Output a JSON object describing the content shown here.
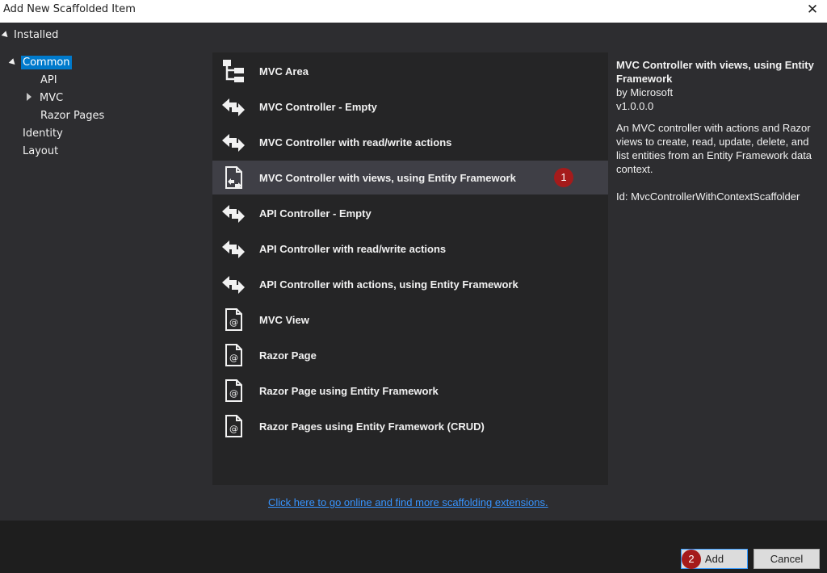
{
  "window": {
    "title": "Add New Scaffolded Item",
    "close_icon": "close-icon"
  },
  "tree": {
    "root_label": "Installed",
    "items": [
      {
        "label": "Common",
        "selected": true
      },
      {
        "label": "API"
      },
      {
        "label": "MVC",
        "expandable": true
      },
      {
        "label": "Razor Pages"
      },
      {
        "label": "Identity"
      },
      {
        "label": "Layout"
      }
    ]
  },
  "templates": [
    {
      "label": "MVC Area",
      "icon": "area-icon"
    },
    {
      "label": "MVC Controller - Empty",
      "icon": "controller-icon"
    },
    {
      "label": "MVC Controller with read/write actions",
      "icon": "controller-icon"
    },
    {
      "label": "MVC Controller with views, using Entity Framework",
      "icon": "controller-views-icon",
      "selected": true,
      "badge": "1"
    },
    {
      "label": "API Controller - Empty",
      "icon": "controller-icon"
    },
    {
      "label": "API Controller with read/write actions",
      "icon": "controller-icon"
    },
    {
      "label": "API Controller with actions, using Entity Framework",
      "icon": "controller-icon"
    },
    {
      "label": "MVC View",
      "icon": "razor-file-icon"
    },
    {
      "label": "Razor Page",
      "icon": "razor-file-icon"
    },
    {
      "label": "Razor Page using Entity Framework",
      "icon": "razor-file-icon"
    },
    {
      "label": "Razor Pages using Entity Framework (CRUD)",
      "icon": "razor-file-icon"
    }
  ],
  "details": {
    "title": "MVC Controller with views, using Entity Framework",
    "author": "by Microsoft",
    "version": "v1.0.0.0",
    "description": "An MVC controller with actions and Razor views to create, read, update, delete, and list entities from an Entity Framework data context.",
    "id_line": "Id: MvcControllerWithContextScaffolder"
  },
  "online_link": "Click here to go online and find more scaffolding extensions.",
  "buttons": {
    "add_label": "Add",
    "add_badge": "2",
    "cancel_label": "Cancel"
  },
  "colors": {
    "accent": "#007acc",
    "badge": "#a51b1b",
    "link": "#3794ff"
  }
}
